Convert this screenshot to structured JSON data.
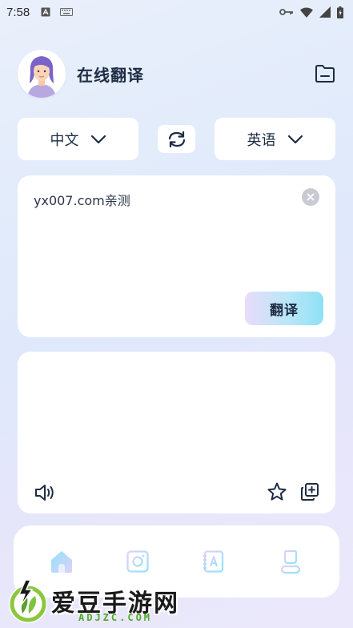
{
  "status_bar": {
    "time": "7:58"
  },
  "header": {
    "title": "在线翻译"
  },
  "languages": {
    "source": "中文",
    "target": "英语"
  },
  "input": {
    "text": "yx007.com亲测",
    "translate_label": "翻译"
  },
  "output": {
    "text": ""
  },
  "bottom_nav": {
    "items": [
      {
        "icon": "home-icon",
        "active": true
      },
      {
        "icon": "camera-icon",
        "active": false
      },
      {
        "icon": "dictionary-icon",
        "active": false
      },
      {
        "icon": "profile-icon",
        "active": false
      }
    ]
  },
  "watermark": {
    "title": "爱豆手游网",
    "subtitle": "ADJZC.COM"
  },
  "colors": {
    "accent_cyan": "#6fd6f2",
    "accent_lavender": "#d9c8f7",
    "text_dark": "#1d2c43"
  }
}
